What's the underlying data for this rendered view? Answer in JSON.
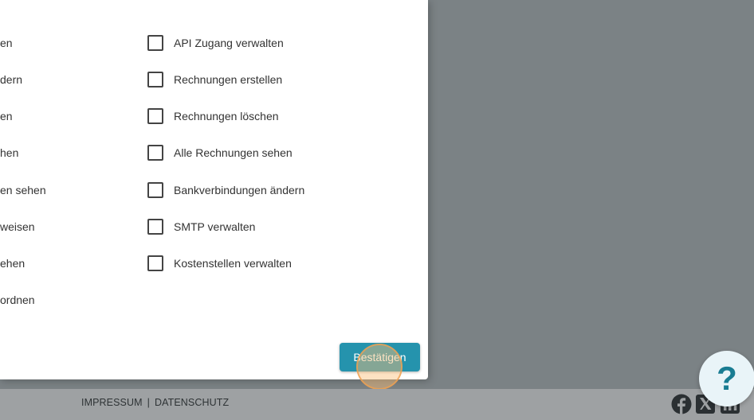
{
  "dialog": {
    "left_column": [
      "en",
      "dern",
      "en",
      "hen",
      "en sehen",
      "weisen",
      "ehen",
      "ordnen"
    ],
    "permissions": [
      {
        "label": "API Zugang verwalten",
        "checked": false
      },
      {
        "label": "Rechnungen erstellen",
        "checked": false
      },
      {
        "label": "Rechnungen löschen",
        "checked": false
      },
      {
        "label": "Alle Rechnungen sehen",
        "checked": false
      },
      {
        "label": "Bankverbindungen ändern",
        "checked": false
      },
      {
        "label": "SMTP verwalten",
        "checked": false
      },
      {
        "label": "Kostenstellen verwalten",
        "checked": false
      }
    ],
    "confirm_label": "Bestätigen"
  },
  "footer": {
    "impressum": "IMPRESSUM",
    "separator": "|",
    "datenschutz": "DATENSCHUTZ"
  },
  "help": {
    "label": "?"
  },
  "social": [
    "facebook-icon",
    "x-icon",
    "linkedin-icon"
  ],
  "colors": {
    "accent": "#2593ad",
    "help_text": "#197c92",
    "overlay": "#7b8285"
  }
}
